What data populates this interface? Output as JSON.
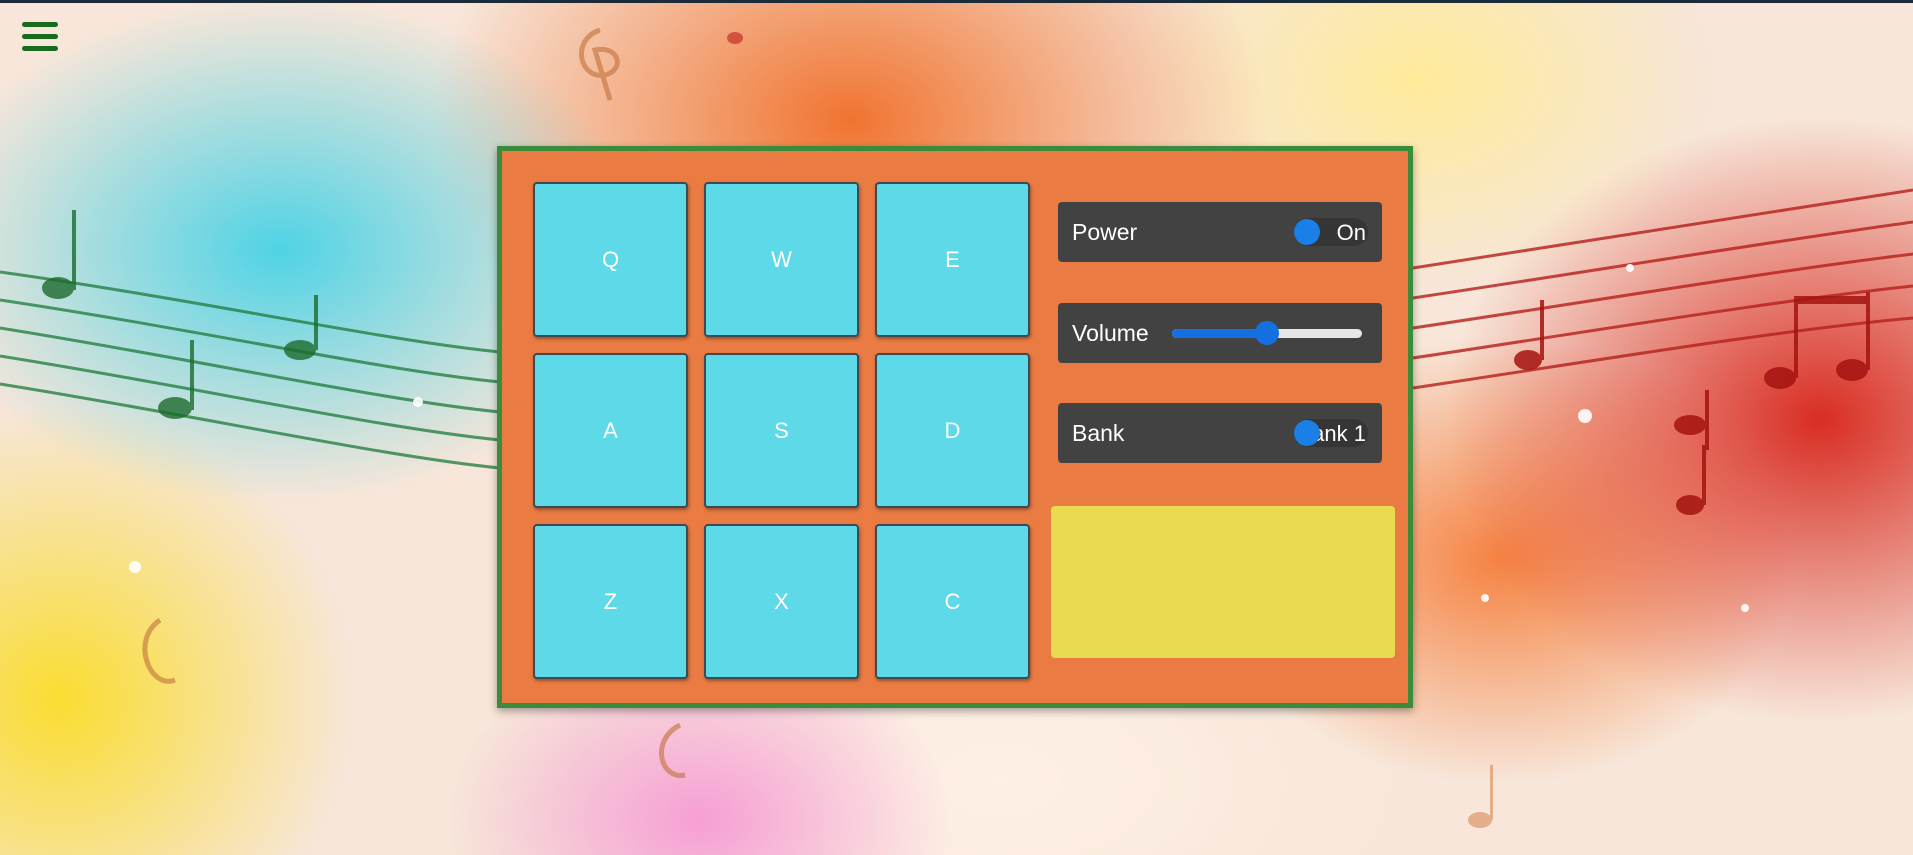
{
  "menu": {
    "icon": "hamburger-icon"
  },
  "pads": [
    {
      "key": "Q"
    },
    {
      "key": "W"
    },
    {
      "key": "E"
    },
    {
      "key": "A"
    },
    {
      "key": "S"
    },
    {
      "key": "D"
    },
    {
      "key": "Z"
    },
    {
      "key": "X"
    },
    {
      "key": "C"
    }
  ],
  "controls": {
    "power": {
      "label": "Power",
      "value": "On"
    },
    "volume": {
      "label": "Volume",
      "level": 0.5
    },
    "bank": {
      "label": "Bank",
      "value": "Bank 1"
    }
  },
  "display": {
    "text": ""
  },
  "colors": {
    "panel": "#e97b43",
    "panel_border": "#3a8c3a",
    "pad": "#5dd9e8",
    "control_bg": "#424242",
    "display": "#eada4f",
    "accent": "#1a7fe6",
    "menu_icon": "#186a1d"
  }
}
